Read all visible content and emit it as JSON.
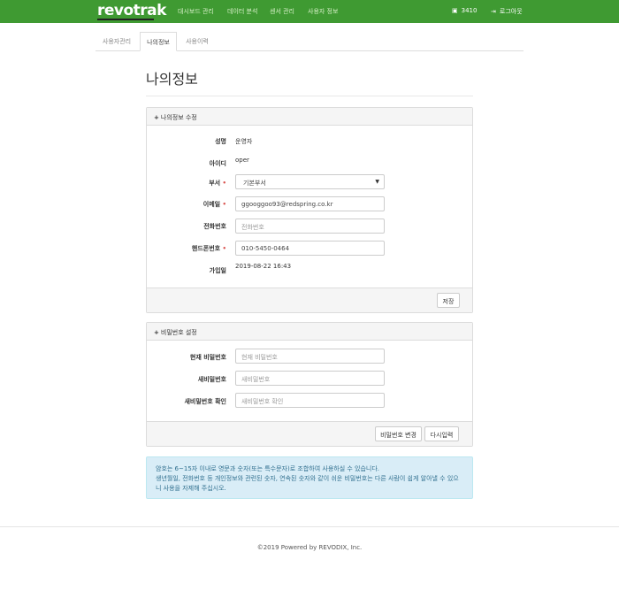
{
  "header": {
    "logo": "revotrak",
    "nav": [
      "대시보드 관리",
      "데이터 분석",
      "센서 관리",
      "사용자 정보"
    ],
    "user_count": "3410",
    "logout": "로그아웃",
    "bar_color": "#3f9a32"
  },
  "tabs": [
    {
      "label": "사용자관리",
      "active": false
    },
    {
      "label": "나의정보",
      "active": true
    },
    {
      "label": "사용이력",
      "active": false
    }
  ],
  "page_title": "나의정보",
  "profile": {
    "heading": "나의정보 수정",
    "name_label": "성명",
    "name_value": "운영자",
    "id_label": "아이디",
    "id_value": "oper",
    "dept_label": "부서",
    "dept_value": "기본부서",
    "email_label": "이메일",
    "email_value": "ggooggoo93@redspring.co.kr",
    "phone_label": "전화번호",
    "phone_placeholder": "전화번호",
    "mobile_label": "핸드폰번호",
    "mobile_value": "010-5450-0464",
    "joined_label": "가입일",
    "joined_value": "2019-08-22 16:43",
    "save_label": "저장"
  },
  "password": {
    "heading": "비밀번호 설정",
    "current_label": "현재 비밀번호",
    "current_placeholder": "현재 비밀번호",
    "new_label": "새비밀번호",
    "new_placeholder": "새비밀번호",
    "confirm_label": "새비밀번호 확인",
    "confirm_placeholder": "새비밀번호 확인",
    "change_label": "비밀번호 변경",
    "reset_label": "다시입력"
  },
  "notice": {
    "line1": "암호는 6~15자 이내로 영문과 숫자(또는 특수문자)로 조합하여 사용하실 수 있습니다.",
    "line2": "생년월일, 전화번호 등 개인정보와 관련된 숫자, 연속된 숫자와 같이 쉬운 비밀번호는 다른 사람이 쉽게 알아낼 수 있으니 사용을 자제해 주십시오."
  },
  "footer": "©2019 Powered by REVODIX, Inc."
}
